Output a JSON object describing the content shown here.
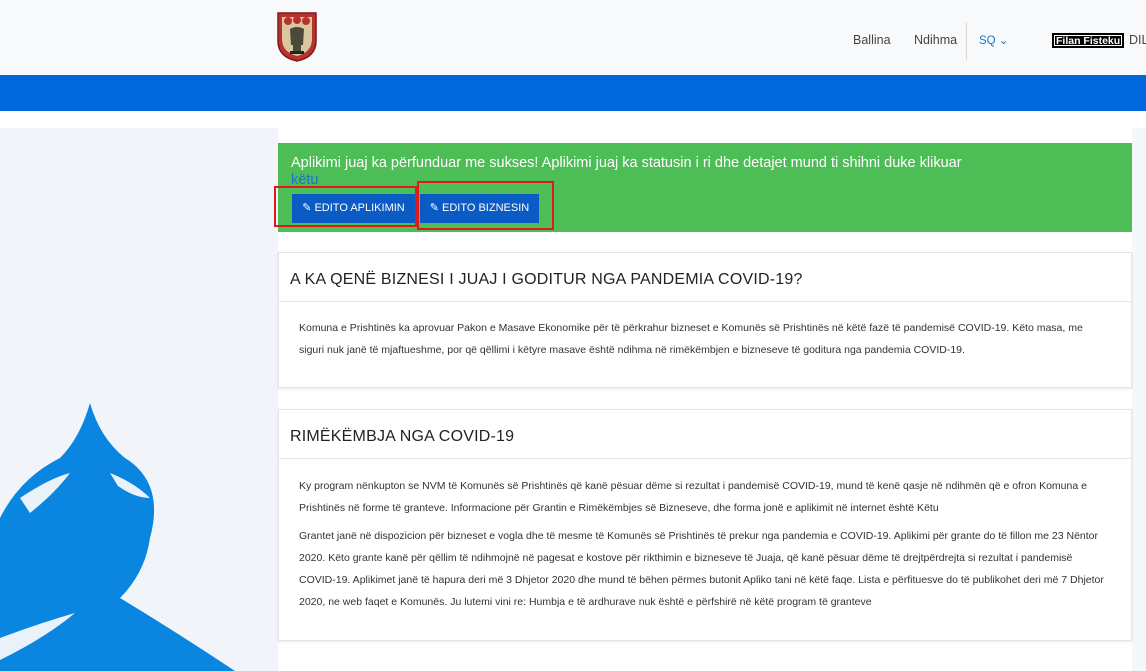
{
  "header": {
    "nav_home": "Ballina",
    "nav_help": "Ndihma",
    "language": "SQ ⌄",
    "user_name": "Filan Fisteku",
    "logout": "DIL"
  },
  "alert": {
    "message": "Aplikimi juaj ka përfunduar me sukses! Aplikimi juaj ka statusin i ri dhe detajet mund ti shihni duke klikuar ",
    "link_text": "këtu",
    "edit_application_label": "EDITO APLIKIMIN",
    "edit_business_label": "EDITO BIZNESIN"
  },
  "card1": {
    "title": "A KA QENË BIZNESI I JUAJ I GODITUR NGA PANDEMIA COVID-19?",
    "body": "Komuna e Prishtinës ka aprovuar Pakon e Masave Ekonomike për të përkrahur bizneset e Komunës së Prishtinës në këtë fazë të pandemisë COVID-19. Këto masa, me siguri nuk janë të mjaftueshme, por që qëllimi i këtyre masave është ndihma në rimëkëmbjen e bizneseve të goditura nga pandemia COVID-19."
  },
  "card2": {
    "title": "RIMËKËMBJA NGA COVID-19",
    "paragraph1": "Ky program nënkupton se NVM të Komunës së Prishtinës që kanë pësuar dëme si rezultat i pandemisë COVID-19, mund të kenë qasje në ndihmën që e ofron Komuna e Prishtinës në forme të granteve. Informacione për Grantin e Rimëkëmbjes së Bizneseve, dhe forma jonë e aplikimit në internet është Këtu",
    "paragraph2": "Grantet janë në dispozicion për bizneset e vogla dhe të mesme të Komunës së Prishtinës të prekur nga pandemia e COVID-19. Aplikimi për grante do të fillon me 23 Nëntor 2020. Këto grante kanë për qëllim të ndihmojnë në pagesat e kostove për rikthimin e bizneseve të Juaja, që kanë pësuar dëme të drejtpërdrejta si rezultat i pandemisë COVID-19. Aplikimet janë të hapura deri më 3 Dhjetor 2020 dhe mund të bëhen përmes butonit Apliko tani në këtë faqe. Lista e përfituesve do të publikohet deri më 7 Dhjetor 2020, ne web faqet e Komunës. Ju lutemi vini re: Humbja e të ardhurave nuk është e përfshirë në këtë program të granteve"
  },
  "colors": {
    "brand_blue": "#0067dc",
    "success_green": "#4dbd56",
    "button_blue": "#0a5cc4",
    "highlight_red": "#e0191d"
  },
  "icons": {
    "logo": "municipality-crest",
    "edit": "edit-icon"
  }
}
